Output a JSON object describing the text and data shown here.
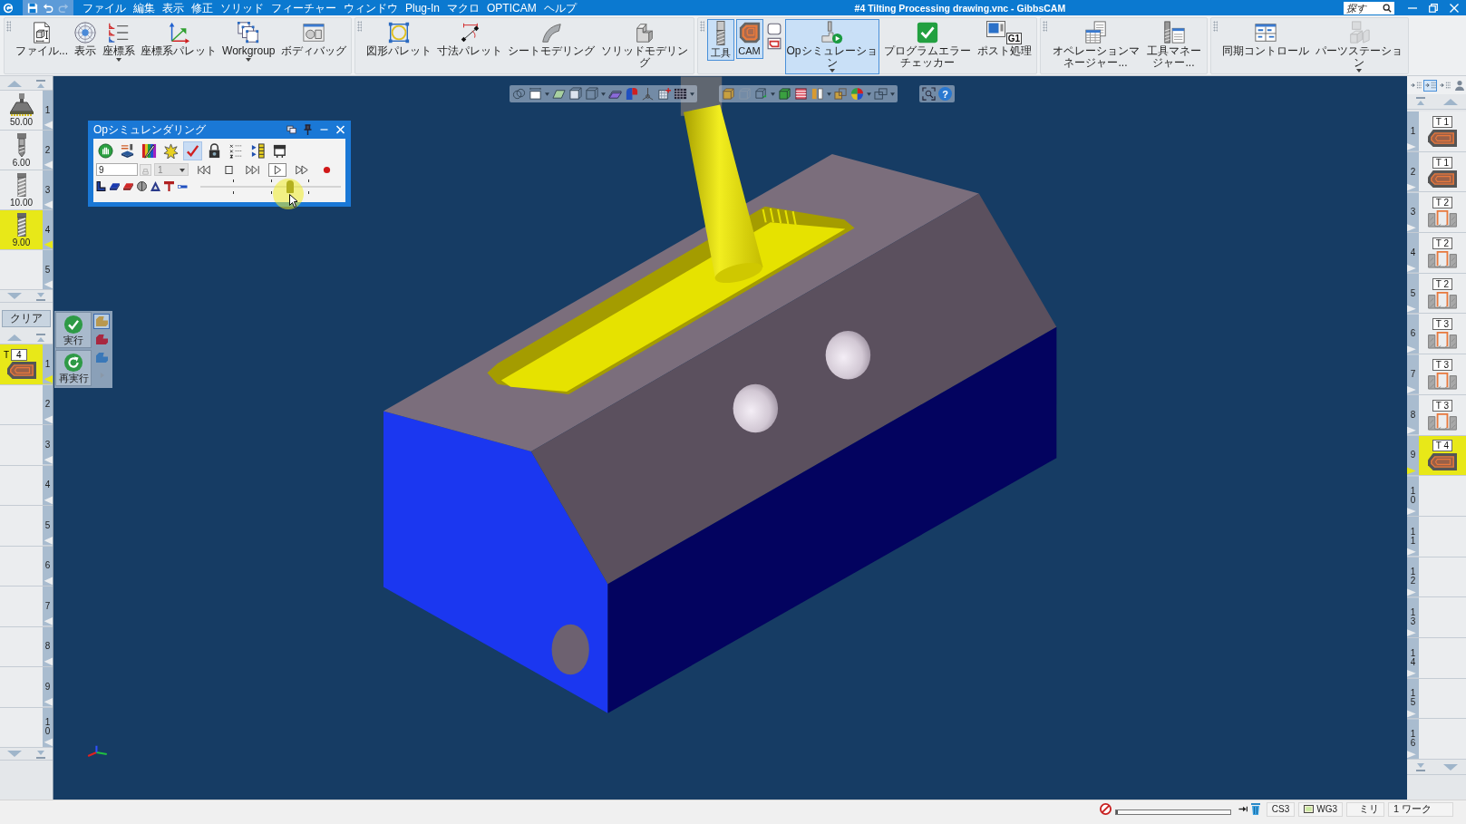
{
  "title_bar": {
    "quick_access": [
      {
        "kind": "save",
        "disabled": false
      },
      {
        "kind": "undo",
        "disabled": false
      },
      {
        "kind": "redo",
        "disabled": true
      }
    ],
    "menu": [
      "ファイル",
      "編集",
      "表示",
      "修正",
      "ソリッド",
      "フィーチャー",
      "ウィンドウ",
      "Plug-In",
      "マクロ",
      "OPTICAM",
      "ヘルプ"
    ],
    "title": "#4 Tilting Processing drawing.vnc - GibbsCAM",
    "search": {
      "placeholder": "探す"
    }
  },
  "toolbar": {
    "groups": [
      {
        "items": [
          {
            "kind": "file",
            "label": "ファイル...",
            "selected": false,
            "caret": false
          },
          {
            "kind": "display",
            "label": "表示",
            "selected": false,
            "caret": false
          },
          {
            "kind": "coord",
            "label": "座標系",
            "selected": false,
            "caret": true
          },
          {
            "kind": "coord-palette",
            "label": "座標系パレット",
            "selected": false,
            "caret": false
          },
          {
            "kind": "workgroup",
            "label": "Workgroup",
            "selected": false,
            "caret": true
          },
          {
            "kind": "body-bag",
            "label": "ボディバッグ",
            "selected": false,
            "caret": false
          }
        ]
      },
      {
        "items": [
          {
            "kind": "shape-palette",
            "label": "図形パレット",
            "selected": false,
            "caret": false
          },
          {
            "kind": "dimension",
            "label": "寸法パレット",
            "selected": false,
            "caret": false
          },
          {
            "kind": "sheet",
            "label": "シートモデリング",
            "selected": false,
            "caret": false
          },
          {
            "kind": "solid",
            "label": "ソリッドモデリング",
            "selected": false,
            "caret": false
          }
        ]
      },
      {
        "items": [
          {
            "kind": "tool",
            "label": "工具",
            "selected": true,
            "caret": false
          },
          {
            "kind": "cam",
            "label": "CAM",
            "selected": true,
            "caret": false
          },
          {
            "kind": "mini-stack",
            "selected": false,
            "caret": false
          },
          {
            "kind": "opsim",
            "label": "Opシミュレーション",
            "selected": true,
            "caret": true
          },
          {
            "kind": "checker",
            "label": "プログラムエラーチェッカー",
            "selected": false,
            "caret": false
          },
          {
            "kind": "post",
            "label": "ポスト処理",
            "badge": "G1",
            "selected": false,
            "caret": false
          }
        ]
      },
      {
        "items": [
          {
            "kind": "op-manager",
            "label": "オペレーションマネージャー...",
            "selected": false,
            "caret": false
          },
          {
            "kind": "tool-manager",
            "label": "工具マネージャー...",
            "selected": false,
            "caret": false
          }
        ]
      },
      {
        "items": [
          {
            "kind": "sync",
            "label": "同期コントロール",
            "selected": false,
            "caret": false
          },
          {
            "kind": "parts",
            "label": "パーツステーション",
            "selected": false,
            "caret": true
          }
        ]
      }
    ]
  },
  "tool_panel": {
    "tools": [
      {
        "number": "1",
        "size": "50.00",
        "kind": "face-mill",
        "selected": false
      },
      {
        "number": "2",
        "size": "6.00",
        "kind": "drill",
        "selected": false
      },
      {
        "number": "3",
        "size": "10.00",
        "kind": "fluted",
        "selected": false
      },
      {
        "number": "4",
        "size": "9.00",
        "kind": "end-mill",
        "selected": true
      },
      {
        "number": "5",
        "kind": "empty",
        "selected": false
      }
    ],
    "clear": "クリア",
    "operations": [
      {
        "number": "1",
        "tool_prefix": "T",
        "tool": "4",
        "kind": "contour",
        "selected": true
      },
      {
        "number": "2",
        "kind": "empty",
        "selected": false
      },
      {
        "number": "3",
        "kind": "empty",
        "selected": false
      },
      {
        "number": "4",
        "kind": "empty",
        "selected": false
      },
      {
        "number": "5",
        "kind": "empty",
        "selected": false
      },
      {
        "number": "6",
        "kind": "empty",
        "selected": false
      },
      {
        "number": "7",
        "kind": "empty",
        "selected": false
      },
      {
        "number": "8",
        "kind": "empty",
        "selected": false
      },
      {
        "number": "9",
        "kind": "empty",
        "selected": false
      },
      {
        "number": "10",
        "kind": "empty",
        "selected": false
      }
    ]
  },
  "run_panel": {
    "buttons": [
      {
        "kind": "run",
        "label": "実行"
      },
      {
        "kind": "rerun",
        "label": "再実行"
      }
    ],
    "modes": [
      {
        "color": "#b89850",
        "selected": true
      },
      {
        "color": "#a82840",
        "selected": false
      },
      {
        "color": "#3a78b8",
        "selected": false
      }
    ]
  },
  "view_toolbar": {
    "help": "?"
  },
  "op_sim": {
    "title": "Opシミュレンダリング",
    "tools": [
      {
        "kind": "stop",
        "selected": false
      },
      {
        "kind": "machine",
        "selected": false
      },
      {
        "kind": "colors",
        "selected": false
      },
      {
        "kind": "burst",
        "selected": false
      },
      {
        "kind": "check",
        "selected": true
      },
      {
        "kind": "lock",
        "selected": false
      },
      {
        "kind": "xyz",
        "selected": false
      },
      {
        "kind": "sequence",
        "selected": false
      },
      {
        "kind": "frame",
        "selected": false
      }
    ],
    "operation": "9",
    "spin_disabled": true,
    "pass": {
      "value": "1",
      "disabled": true
    },
    "playback": [
      {
        "kind": "first",
        "selected": false
      },
      {
        "kind": "stop",
        "selected": false
      },
      {
        "kind": "step",
        "selected": false
      },
      {
        "kind": "play",
        "selected": true
      },
      {
        "kind": "forward",
        "selected": false
      },
      {
        "kind": "record",
        "selected": false
      }
    ],
    "slider": {
      "level": 0.64
    }
  },
  "operation_strip": {
    "view_modes": [
      {
        "selected": false
      },
      {
        "selected": true
      },
      {
        "selected": false
      }
    ],
    "operations": [
      {
        "number": "1",
        "tool": "T 1",
        "kind": "contour",
        "selected": false
      },
      {
        "number": "2",
        "tool": "T 1",
        "kind": "contour",
        "selected": false
      },
      {
        "number": "3",
        "tool": "T 2",
        "kind": "groove",
        "selected": false
      },
      {
        "number": "4",
        "tool": "T 2",
        "kind": "groove",
        "selected": false
      },
      {
        "number": "5",
        "tool": "T 2",
        "kind": "groove",
        "selected": false
      },
      {
        "number": "6",
        "tool": "T 3",
        "kind": "groove",
        "selected": false
      },
      {
        "number": "7",
        "tool": "T 3",
        "kind": "groove",
        "selected": false
      },
      {
        "number": "8",
        "tool": "T 3",
        "kind": "groove",
        "selected": false
      },
      {
        "number": "9",
        "tool": "T 4",
        "kind": "contour",
        "selected": true
      },
      {
        "number": "10",
        "kind": "empty",
        "selected": false
      },
      {
        "number": "11",
        "kind": "empty",
        "selected": false
      },
      {
        "number": "12",
        "kind": "empty",
        "selected": false
      },
      {
        "number": "13",
        "kind": "empty",
        "selected": false
      },
      {
        "number": "14",
        "kind": "empty",
        "selected": false
      },
      {
        "number": "15",
        "kind": "empty",
        "selected": false
      },
      {
        "number": "16",
        "kind": "empty",
        "selected": false
      }
    ]
  },
  "status_bar": {
    "progress": {
      "level": 0
    },
    "coordinate_system": "CS3",
    "workgroup": "WG3",
    "units": "ミリ",
    "workpiece": "1 ワーク"
  }
}
